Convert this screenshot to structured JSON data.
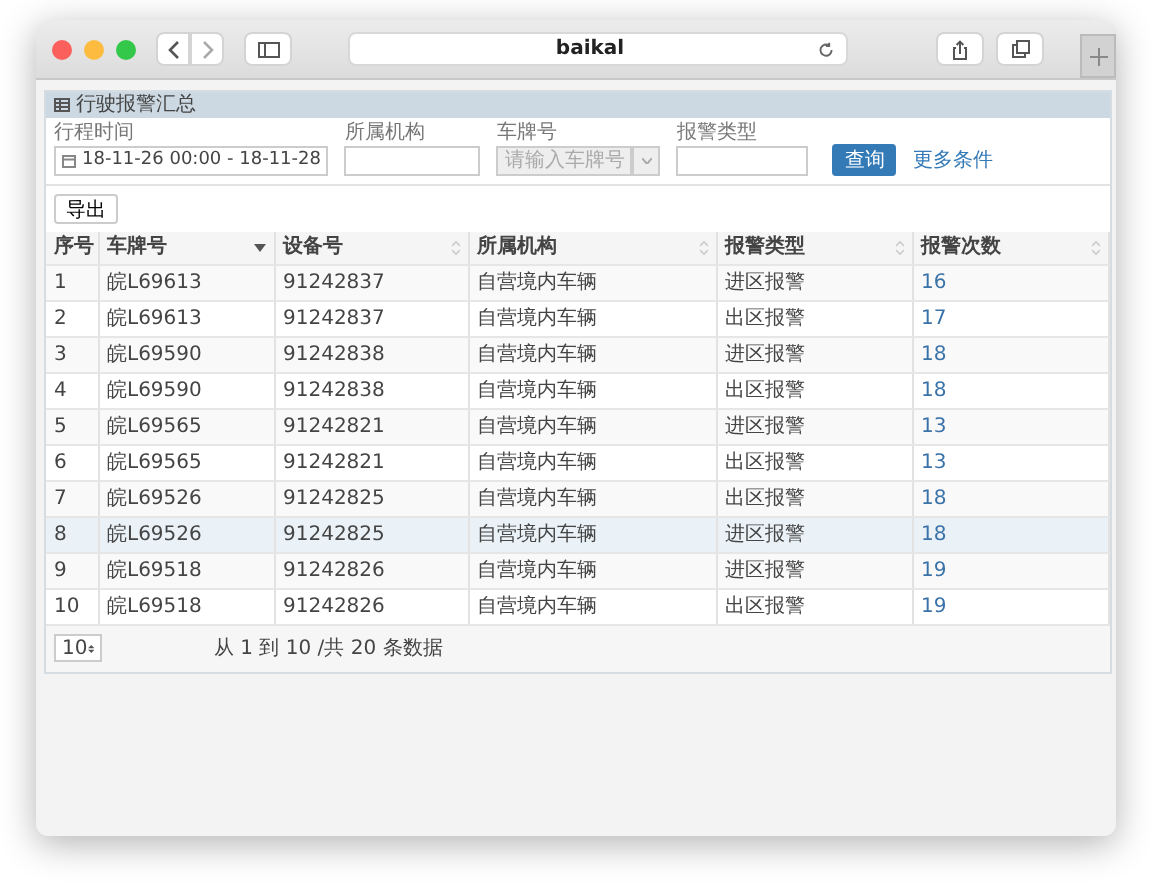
{
  "browser": {
    "address": "baikal"
  },
  "panel": {
    "title": "行驶报警汇总"
  },
  "filters": [
    {
      "label": "行程时间",
      "kind": "date",
      "value": "18-11-26 00:00 - 18-11-28"
    },
    {
      "label": "所属机构",
      "kind": "text"
    },
    {
      "label": "车牌号",
      "kind": "select",
      "placeholder": "请输入车牌号",
      "disabled": true
    },
    {
      "label": "报警类型",
      "kind": "text"
    }
  ],
  "search_button": "查询",
  "more_link": "更多条件",
  "export_button": "导出",
  "table": {
    "columns": [
      {
        "label": "序号"
      },
      {
        "label": "车牌号",
        "sortable": true,
        "sorted_descending": true
      },
      {
        "label": "设备号",
        "sortable": true,
        "sorted_descending": false
      },
      {
        "label": "所属机构",
        "sortable": true,
        "sorted_descending": false
      },
      {
        "label": "报警类型",
        "sortable": true,
        "sorted_descending": false
      },
      {
        "label": "报警次数",
        "sortable": true,
        "sorted_descending": false
      }
    ],
    "rows": [
      {
        "cells": [
          "1",
          "皖L69613",
          "91242837",
          "自营境内车辆",
          "进区报警",
          "16"
        ],
        "selected": false
      },
      {
        "cells": [
          "2",
          "皖L69613",
          "91242837",
          "自营境内车辆",
          "出区报警",
          "17"
        ],
        "selected": false
      },
      {
        "cells": [
          "3",
          "皖L69590",
          "91242838",
          "自营境内车辆",
          "进区报警",
          "18"
        ],
        "selected": false
      },
      {
        "cells": [
          "4",
          "皖L69590",
          "91242838",
          "自营境内车辆",
          "出区报警",
          "18"
        ],
        "selected": false
      },
      {
        "cells": [
          "5",
          "皖L69565",
          "91242821",
          "自营境内车辆",
          "进区报警",
          "13"
        ],
        "selected": false
      },
      {
        "cells": [
          "6",
          "皖L69565",
          "91242821",
          "自营境内车辆",
          "出区报警",
          "13"
        ],
        "selected": false
      },
      {
        "cells": [
          "7",
          "皖L69526",
          "91242825",
          "自营境内车辆",
          "出区报警",
          "18"
        ],
        "selected": false
      },
      {
        "cells": [
          "8",
          "皖L69526",
          "91242825",
          "自营境内车辆",
          "进区报警",
          "18"
        ],
        "selected": true
      },
      {
        "cells": [
          "9",
          "皖L69518",
          "91242826",
          "自营境内车辆",
          "进区报警",
          "19"
        ],
        "selected": false
      },
      {
        "cells": [
          "10",
          "皖L69518",
          "91242826",
          "自营境内车辆",
          "出区报警",
          "19"
        ],
        "selected": false
      }
    ]
  },
  "pager": {
    "page_size": "10",
    "summary": "从 1 到 10 /共 20 条数据"
  }
}
